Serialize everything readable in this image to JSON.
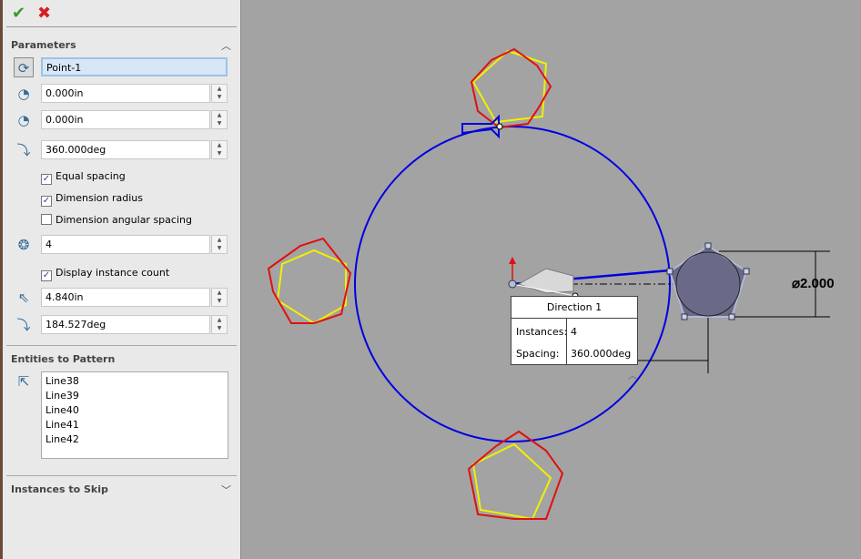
{
  "toolbar": {
    "ok_icon": "check-icon",
    "cancel_icon": "x-icon",
    "ok": "✔",
    "cancel": "✖"
  },
  "parameters": {
    "title": "Parameters",
    "center": "Point-1",
    "x": "0.000in",
    "y": "0.000in",
    "angle": "360.000deg",
    "equal_spacing": {
      "label": "Equal spacing",
      "checked": true
    },
    "dimension_radius": {
      "label": "Dimension radius",
      "checked": true
    },
    "dimension_angular": {
      "label": "Dimension angular spacing",
      "checked": false
    },
    "instances": "4",
    "display_count": {
      "label": "Display instance count",
      "checked": true
    },
    "radius": "4.840in",
    "arc_angle": "184.527deg"
  },
  "entities": {
    "title": "Entities to Pattern",
    "items": [
      "Line38",
      "Line39",
      "Line40",
      "Line41",
      "Line42"
    ]
  },
  "skip": {
    "title": "Instances to Skip"
  },
  "popup": {
    "title": "Direction 1",
    "instances_label": "Instances:",
    "instances": "4",
    "spacing_label": "Spacing:",
    "spacing": "360.000deg"
  },
  "dimension": "⌀2.000",
  "colors": {
    "circle": "#0000e0",
    "sketch_red": "#e01010",
    "preview_yellow": "#f0f000",
    "canvas": "#a3a3a3"
  }
}
